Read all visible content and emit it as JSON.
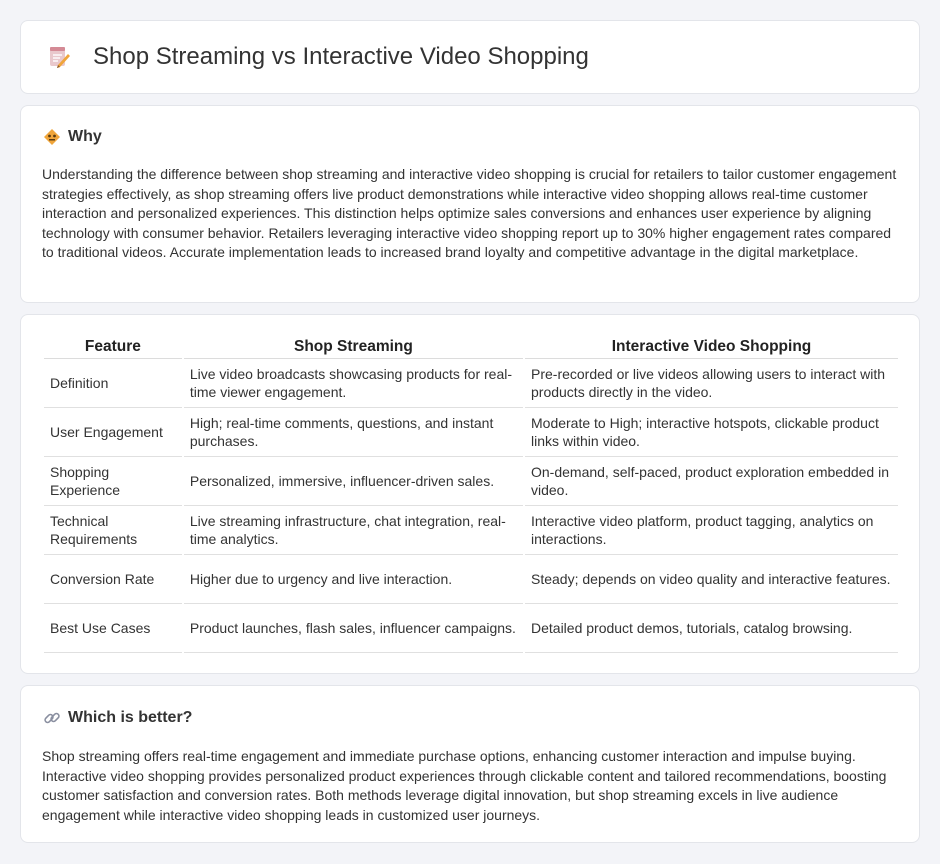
{
  "page": {
    "title": "Shop Streaming vs Interactive Video Shopping",
    "title_icon": "notepad-pencil-icon"
  },
  "why": {
    "icon": "diamond-warning-icon",
    "heading": "Why",
    "text": "Understanding the difference between shop streaming and interactive video shopping is crucial for retailers to tailor customer engagement strategies effectively, as shop streaming offers live product demonstrations while interactive video shopping allows real-time customer interaction and personalized experiences. This distinction helps optimize sales conversions and enhances user experience by aligning technology with consumer behavior. Retailers leveraging interactive video shopping report up to 30% higher engagement rates compared to traditional videos. Accurate implementation leads to increased brand loyalty and competitive advantage in the digital marketplace."
  },
  "table": {
    "headers": [
      "Feature",
      "Shop Streaming",
      "Interactive Video Shopping"
    ],
    "rows": [
      [
        "Definition",
        "Live video broadcasts showcasing products for real-time viewer engagement.",
        "Pre-recorded or live videos allowing users to interact with products directly in the video."
      ],
      [
        "User Engagement",
        "High; real-time comments, questions, and instant purchases.",
        "Moderate to High; interactive hotspots, clickable product links within video."
      ],
      [
        "Shopping Experience",
        "Personalized, immersive, influencer-driven sales.",
        "On-demand, self-paced, product exploration embedded in video."
      ],
      [
        "Technical Requirements",
        "Live streaming infrastructure, chat integration, real-time analytics.",
        "Interactive video platform, product tagging, analytics on interactions."
      ],
      [
        "Conversion Rate",
        "Higher due to urgency and live interaction.",
        "Steady; depends on video quality and interactive features."
      ],
      [
        "Best Use Cases",
        "Product launches, flash sales, influencer campaigns.",
        "Detailed product demos, tutorials, catalog browsing."
      ]
    ]
  },
  "better": {
    "icon": "link-icon",
    "heading": "Which is better?",
    "text": "Shop streaming offers real-time engagement and immediate purchase options, enhancing customer interaction and impulse buying. Interactive video shopping provides personalized product experiences through clickable content and tailored recommendations, boosting customer satisfaction and conversion rates. Both methods leverage digital innovation, but shop streaming excels in live audience engagement while interactive video shopping leads in customized user journeys."
  },
  "colors": {
    "background": "#f3f4f8",
    "card": "#ffffff",
    "icon_orange": "#f0a53a",
    "icon_pink": "#e8a0a8"
  }
}
